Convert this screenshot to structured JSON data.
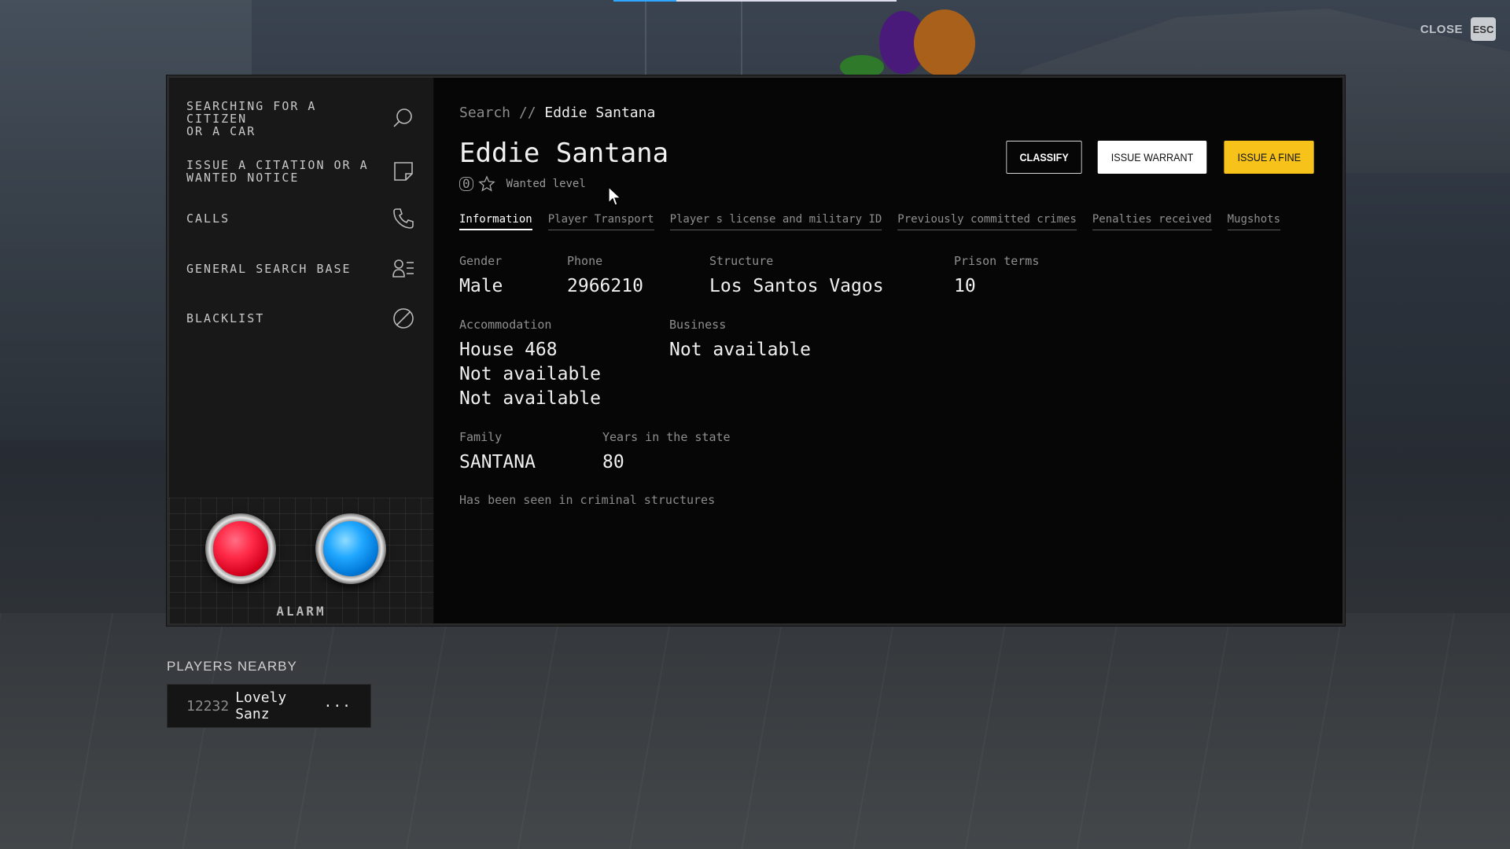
{
  "window": {
    "close_label": "CLOSE",
    "esc_label": "ESC"
  },
  "sidebar": {
    "items": [
      {
        "label": "SEARCHING FOR A\nCITIZEN\nOR A CAR",
        "icon": "search-icon"
      },
      {
        "label": "ISSUE A CITATION OR A\nWANTED NOTICE",
        "icon": "note-icon"
      },
      {
        "label": "CALLS",
        "icon": "phone-icon"
      },
      {
        "label": "GENERAL SEARCH BASE",
        "icon": "user-list-icon"
      },
      {
        "label": "BLACKLIST",
        "icon": "ban-icon"
      }
    ],
    "alarm_label": "ALARM",
    "alarm_colors": {
      "red": "#ff2b48",
      "blue": "#21a8ff"
    }
  },
  "breadcrumb": {
    "root": "Search",
    "separator": "//",
    "current": "Eddie Santana"
  },
  "person": {
    "name": "Eddie Santana",
    "wanted_count": "0",
    "wanted_label": "Wanted level"
  },
  "actions": {
    "classify": "CLASSIFY",
    "warrant": "ISSUE WARRANT",
    "fine": "ISSUE A FINE",
    "fine_color": "#f7c21a"
  },
  "tabs": [
    "Information",
    "Player Transport",
    "Player s license and military ID",
    "Previously committed crimes",
    "Penalties received",
    "Mugshots"
  ],
  "info": {
    "gender": {
      "label": "Gender",
      "value": "Male"
    },
    "phone": {
      "label": "Phone",
      "value": "2966210"
    },
    "structure": {
      "label": "Structure",
      "value": "Los Santos Vagos"
    },
    "prison": {
      "label": "Prison terms",
      "value": "10"
    },
    "accommodation": {
      "label": "Accommodation",
      "values": [
        "House 468",
        "Not available",
        "Not available"
      ]
    },
    "business": {
      "label": "Business",
      "value": "Not available"
    },
    "family": {
      "label": "Family",
      "value": "SANTANA"
    },
    "years": {
      "label": "Years in the state",
      "value": "80"
    },
    "note": "Has been seen in criminal structures"
  },
  "players_nearby": {
    "title": "PLAYERS NEARBY",
    "players": [
      {
        "id": "12232",
        "name": "Lovely Sanz",
        "more": "···"
      }
    ]
  }
}
